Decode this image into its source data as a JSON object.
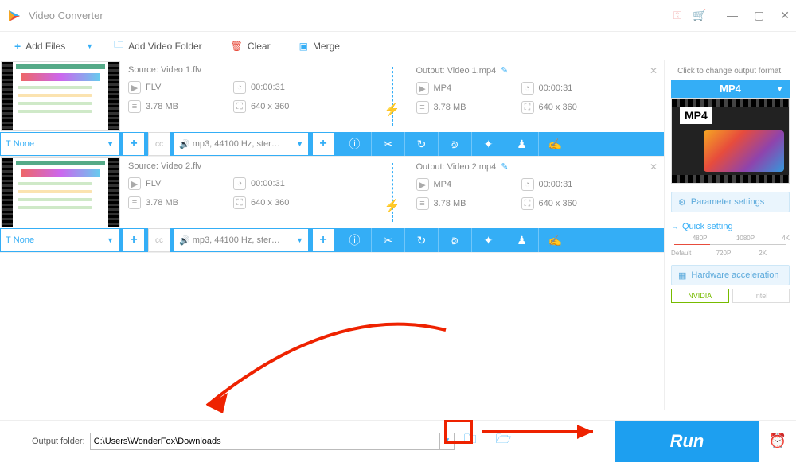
{
  "title": "Video Converter",
  "toolbar": {
    "add_files": "Add Files",
    "add_folder": "Add Video Folder",
    "clear": "Clear",
    "merge": "Merge"
  },
  "items": [
    {
      "source_label": "Source: Video 1.flv",
      "output_label": "Output: Video 1.mp4",
      "src_fmt": "FLV",
      "src_dur": "00:00:31",
      "src_size": "3.78 MB",
      "src_res": "640 x 360",
      "out_fmt": "MP4",
      "out_dur": "00:00:31",
      "out_size": "3.78 MB",
      "out_res": "640 x 360",
      "sub": "None",
      "audio": "mp3, 44100 Hz, ster…"
    },
    {
      "source_label": "Source: Video 2.flv",
      "output_label": "Output: Video 2.mp4",
      "src_fmt": "FLV",
      "src_dur": "00:00:31",
      "src_size": "3.78 MB",
      "src_res": "640 x 360",
      "out_fmt": "MP4",
      "out_dur": "00:00:31",
      "out_size": "3.78 MB",
      "out_res": "640 x 360",
      "sub": "None",
      "audio": "mp3, 44100 Hz, ster…"
    }
  ],
  "sidebar": {
    "change_label": "Click to change output format:",
    "format": "MP4",
    "param_btn": "Parameter settings",
    "quick_setting": "Quick setting",
    "scale": [
      "Default",
      "480P",
      "720P",
      "1080P",
      "2K",
      "4K"
    ],
    "hw_btn": "Hardware acceleration",
    "nvidia": "NVIDIA",
    "intel": "Intel"
  },
  "footer": {
    "label": "Output folder:",
    "path": "C:\\Users\\WonderFox\\Downloads",
    "run": "Run"
  }
}
